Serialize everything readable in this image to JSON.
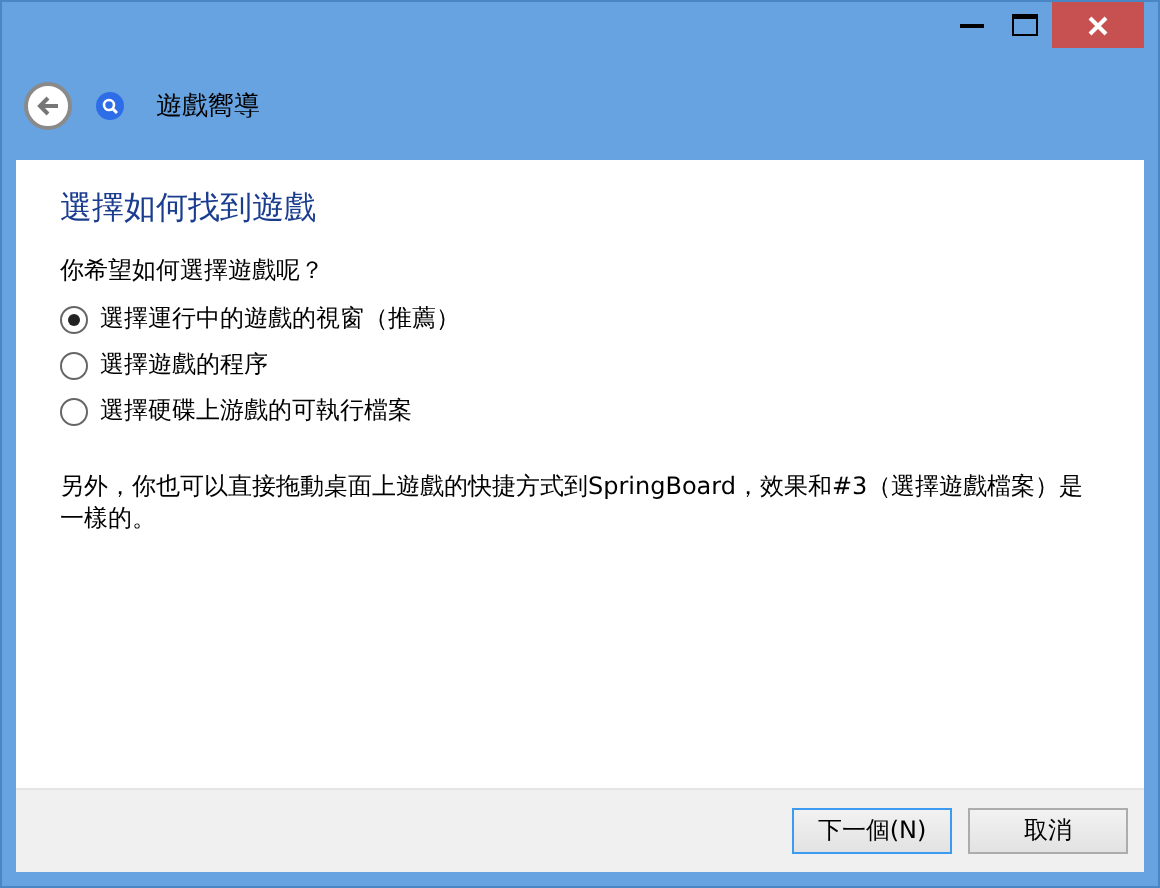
{
  "window": {
    "title": "遊戲嚮導",
    "controls": [
      {
        "kind": "minimize"
      },
      {
        "kind": "maximize"
      },
      {
        "kind": "close"
      }
    ]
  },
  "heading": "選擇如何找到遊戲",
  "question": "你希望如何選擇遊戲呢？",
  "options": [
    {
      "label": "選擇運行中的遊戲的視窗（推薦）",
      "selected": true
    },
    {
      "label": "選擇遊戲的程序",
      "selected": false
    },
    {
      "label": "選擇硬碟上游戲的可執行檔案",
      "selected": false
    }
  ],
  "note": "另外，你也可以直接拖動桌面上遊戲的快捷方式到SpringBoard，效果和#3（選擇遊戲檔案）是一樣的。",
  "buttons": [
    {
      "label": "下一個(N)",
      "default": true
    },
    {
      "label": "取消",
      "default": false
    }
  ]
}
